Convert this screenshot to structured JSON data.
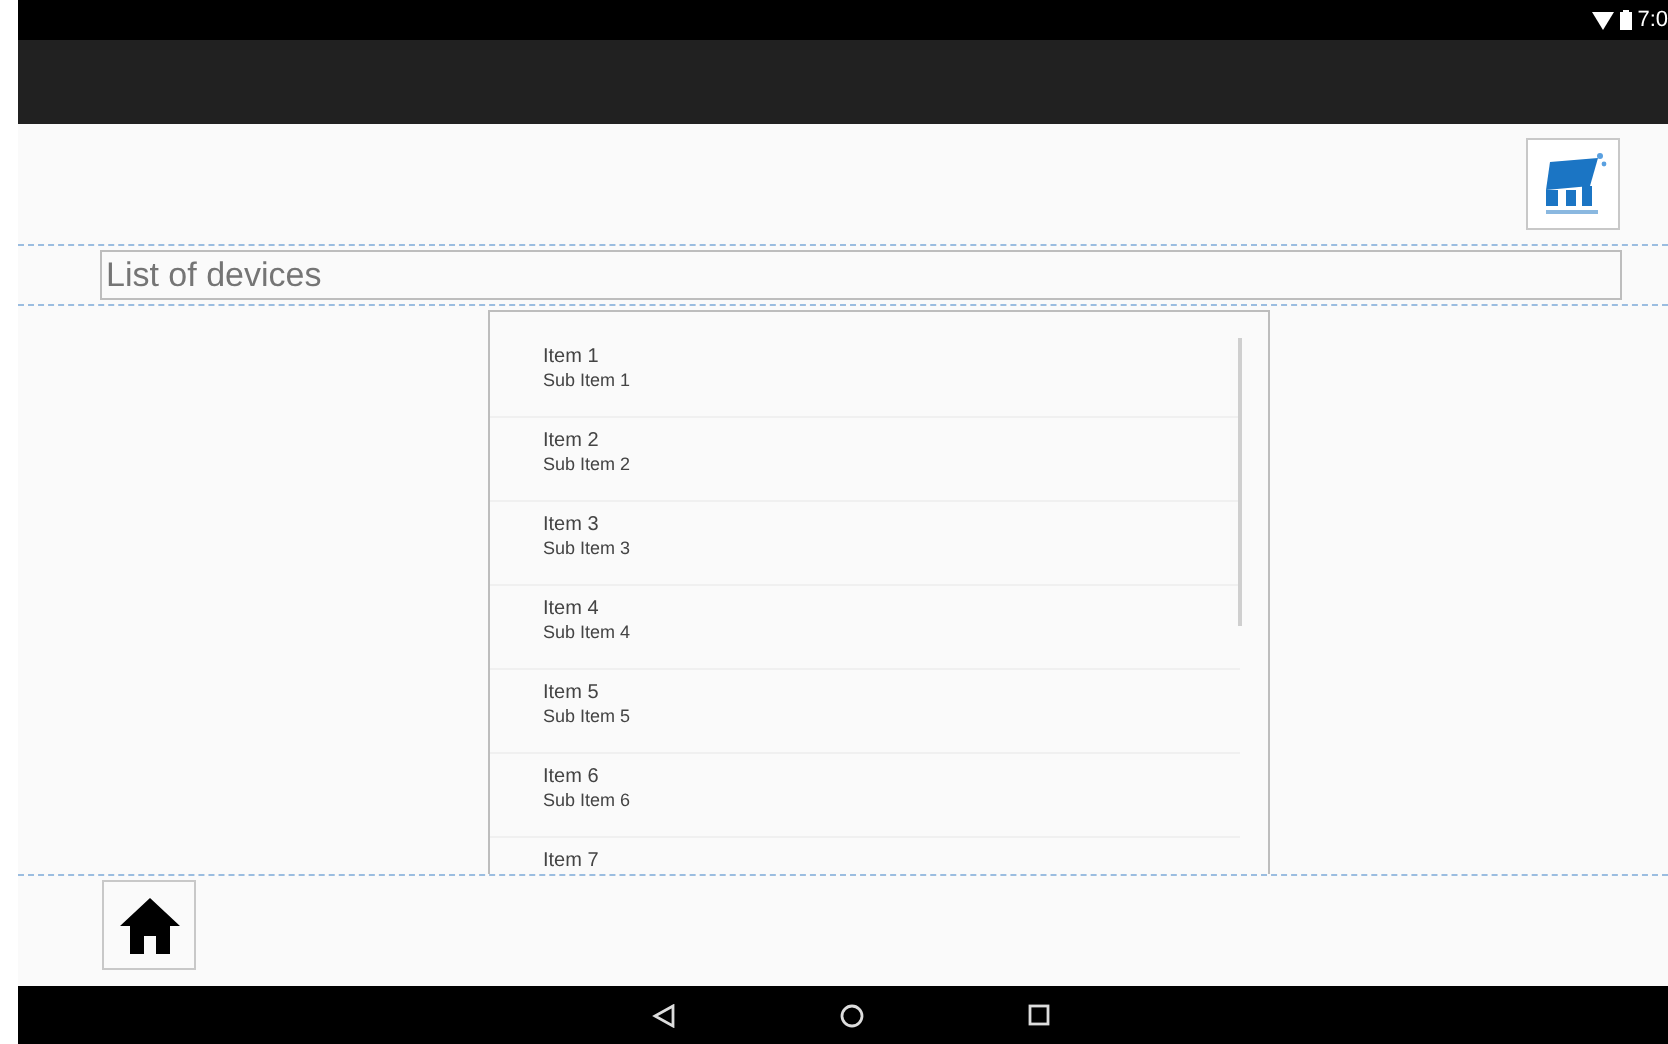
{
  "status_bar": {
    "time": "7:0"
  },
  "title_field": {
    "value": "List of devices"
  },
  "devices": [
    {
      "title": "Item 1",
      "subtitle": "Sub Item 1"
    },
    {
      "title": "Item 2",
      "subtitle": "Sub Item 2"
    },
    {
      "title": "Item 3",
      "subtitle": "Sub Item 3"
    },
    {
      "title": "Item 4",
      "subtitle": "Sub Item 4"
    },
    {
      "title": "Item 5",
      "subtitle": "Sub Item 5"
    },
    {
      "title": "Item 6",
      "subtitle": "Sub Item 6"
    },
    {
      "title": "Item 7"
    }
  ]
}
